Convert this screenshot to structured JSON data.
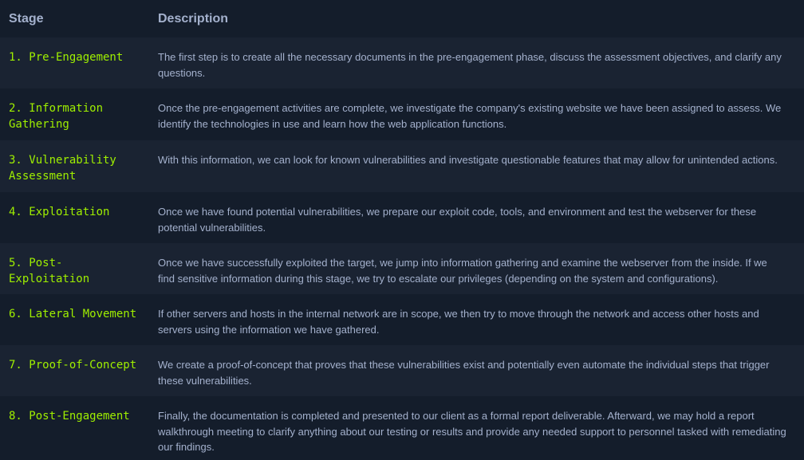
{
  "table": {
    "headers": {
      "stage": "Stage",
      "description": "Description"
    },
    "rows": [
      {
        "stage": "1. Pre-Engagement",
        "description": "The first step is to create all the necessary documents in the pre-engagement phase, discuss the assessment objectives, and clarify any questions."
      },
      {
        "stage": "2. Information\nGathering",
        "description": "Once the pre-engagement activities are complete, we investigate the company's existing website we have been assigned to assess. We identify the technologies in use and learn how the web application functions."
      },
      {
        "stage": "3. Vulnerability\nAssessment",
        "description": "With this information, we can look for known vulnerabilities and investigate questionable features that may allow for unintended actions."
      },
      {
        "stage": "4. Exploitation",
        "description": "Once we have found potential vulnerabilities, we prepare our exploit code, tools, and environment and test the webserver for these potential vulnerabilities."
      },
      {
        "stage": "5. Post-\nExploitation",
        "description": "Once we have successfully exploited the target, we jump into information gathering and examine the webserver from the inside. If we find sensitive information during this stage, we try to escalate our privileges (depending on the system and configurations)."
      },
      {
        "stage": "6. Lateral Movement",
        "description": "If other servers and hosts in the internal network are in scope, we then try to move through the network and access other hosts and servers using the information we have gathered."
      },
      {
        "stage": "7. Proof-of-Concept",
        "description": "We create a proof-of-concept that proves that these vulnerabilities exist and potentially even automate the individual steps that trigger these vulnerabilities."
      },
      {
        "stage": "8. Post-Engagement",
        "description": "Finally, the documentation is completed and presented to our client as a formal report deliverable. Afterward, we may hold a report walkthrough meeting to clarify anything about our testing or results and provide any needed support to personnel tasked with remediating our findings."
      }
    ]
  }
}
